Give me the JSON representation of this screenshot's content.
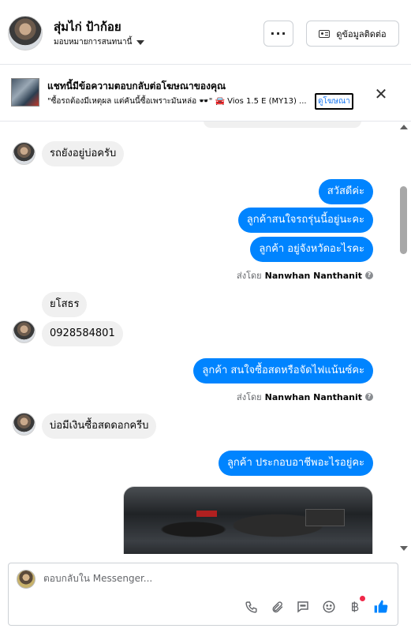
{
  "header": {
    "name": "สุ่มไก่ ป้าก้อย",
    "assign_label": "มอบหมายการสนทนานี้",
    "more_label": "···",
    "contact_label": "ดูข้อมูลติดต่อ"
  },
  "banner": {
    "title": "แชทนี้มีข้อความตอบกลับต่อโฆษณาของคุณ",
    "description": "\"ซื้อรถต้องมีเหตุผล แต่คันนี้ซื้อเพราะมันหล่อ 🕶️\" 🚘 Vios 1.5 E (MY13) ...",
    "link_label": "ดูโฆษณา",
    "close_label": "✕"
  },
  "messages": {
    "in_1": "รถยังอยู่บ่อครับ",
    "out_1": "สวัสดีค่ะ",
    "out_2": "ลูกค้าสนใจรถรุ่นนี้อยู่นะคะ",
    "out_3": "ลูกค้า อยู่จังหวัดอะไรคะ",
    "sent_by_prefix": "ส่งโดย",
    "sent_by_name": "Nanwhan Nanthanit",
    "in_2": "ยโสธร",
    "in_3": "0928584801",
    "out_4": "ลูกค้า สนใจซื้อสดหรือจัดไฟแน้นซ์คะ",
    "in_4": "บ่อมีเงินซื้อสดดอกครีบ",
    "out_5": "ลูกค้า ประกอบอาชีพอะไรอยู่คะ"
  },
  "composer": {
    "placeholder": "ตอบกลับใน Messenger...",
    "tools": [
      "phone-icon",
      "paperclip-icon",
      "chat-bubble-icon",
      "emoji-icon",
      "baht-icon",
      "thumbs-up-icon"
    ]
  },
  "colors": {
    "outgoing_bubble": "#0084ff",
    "incoming_bubble": "#f0f0f0",
    "link": "#1877f2"
  }
}
